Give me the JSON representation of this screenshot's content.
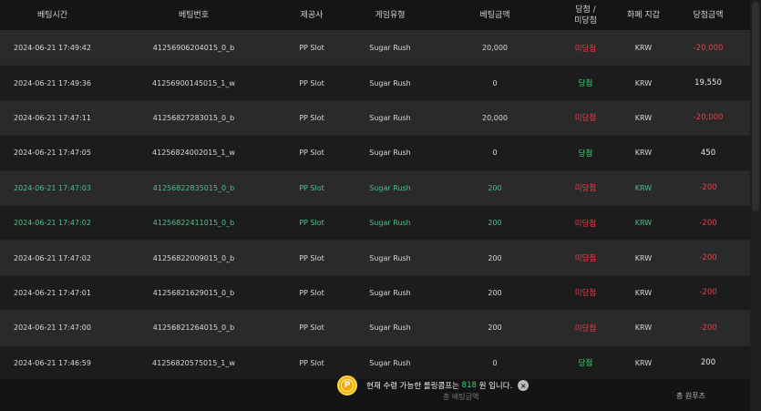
{
  "header": {
    "bet_time": "베팅시간",
    "bet_no": "베팅번호",
    "provider": "제공사",
    "game_type": "게임유형",
    "bet_amount": "베팅금액",
    "result_line1": "당첨 /",
    "result_line2": "미당첨",
    "currency": "화폐 지갑",
    "win_amount": "당첨금액"
  },
  "rows": [
    {
      "time": "2024-06-21 17:49:42",
      "no": "41256906204015_0_b",
      "provider": "PP Slot",
      "game": "Sugar Rush",
      "amount": "20,000",
      "result": "미당첨",
      "currency": "KRW",
      "payout": "-20,000"
    },
    {
      "time": "2024-06-21 17:49:36",
      "no": "41256900145015_1_w",
      "provider": "PP Slot",
      "game": "Sugar Rush",
      "amount": "0",
      "result": "당첨",
      "currency": "KRW",
      "payout": "19,550"
    },
    {
      "time": "2024-06-21 17:47:11",
      "no": "41256827283015_0_b",
      "provider": "PP Slot",
      "game": "Sugar Rush",
      "amount": "20,000",
      "result": "미당첨",
      "currency": "KRW",
      "payout": "-20,000"
    },
    {
      "time": "2024-06-21 17:47:05",
      "no": "41256824002015_1_w",
      "provider": "PP Slot",
      "game": "Sugar Rush",
      "amount": "0",
      "result": "당첨",
      "currency": "KRW",
      "payout": "450"
    },
    {
      "time": "2024-06-21 17:47:03",
      "no": "41256822835015_0_b",
      "provider": "PP Slot",
      "game": "Sugar Rush",
      "amount": "200",
      "result": "미당첨",
      "currency": "KRW",
      "payout": "-200"
    },
    {
      "time": "2024-06-21 17:47:02",
      "no": "41256822411015_0_b",
      "provider": "PP Slot",
      "game": "Sugar Rush",
      "amount": "200",
      "result": "미당첨",
      "currency": "KRW",
      "payout": "-200"
    },
    {
      "time": "2024-06-21 17:47:02",
      "no": "41256822009015_0_b",
      "provider": "PP Slot",
      "game": "Sugar Rush",
      "amount": "200",
      "result": "미당첨",
      "currency": "KRW",
      "payout": "-200"
    },
    {
      "time": "2024-06-21 17:47:01",
      "no": "41256821629015_0_b",
      "provider": "PP Slot",
      "game": "Sugar Rush",
      "amount": "200",
      "result": "미당첨",
      "currency": "KRW",
      "payout": "-200"
    },
    {
      "time": "2024-06-21 17:47:00",
      "no": "41256821264015_0_b",
      "provider": "PP Slot",
      "game": "Sugar Rush",
      "amount": "200",
      "result": "미당첨",
      "currency": "KRW",
      "payout": "-200"
    },
    {
      "time": "2024-06-21 17:46:59",
      "no": "41256820575015_1_w",
      "provider": "PP Slot",
      "game": "Sugar Rush",
      "amount": "0",
      "result": "당첨",
      "currency": "KRW",
      "payout": "200"
    }
  ],
  "footer": {
    "total_label": "총 원푸즈",
    "under_label": "총 배팅금액"
  },
  "toast": {
    "coin_letter": "P",
    "text_before": "현재 수령 가능한 롤링콤프는",
    "points": "818",
    "text_after": "원 입니다.",
    "close": "×"
  },
  "colors": {
    "win": "#3bd16f",
    "lose": "#e0404a",
    "highlight": "#4fc08d",
    "coin": "#f5b400"
  }
}
